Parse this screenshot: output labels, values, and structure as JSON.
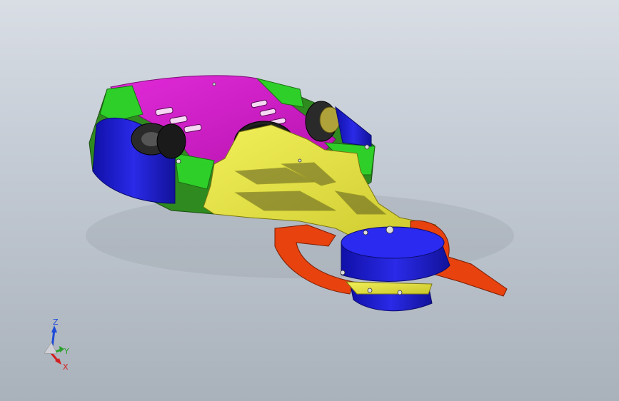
{
  "viewport": {
    "background_top": "#d9dee5",
    "background_bottom": "#a9b1bb"
  },
  "model": {
    "part_colors": {
      "top_plate": "#d21fcc",
      "corner_blocks": "#2fcf2a",
      "side_frame": "#2f8a1f",
      "wheel_pods": "#1e1ec8",
      "frame_arm": "#e3e23c",
      "claw": "#e8420e",
      "hub": "#1e1ec8",
      "wheel": "#2a2a2a"
    }
  },
  "triad": {
    "z_label": "Z",
    "y_label": "Y",
    "x_label": "X",
    "z_color": "#1e4bd8",
    "y_color": "#2aa02a",
    "x_color": "#d22020"
  }
}
